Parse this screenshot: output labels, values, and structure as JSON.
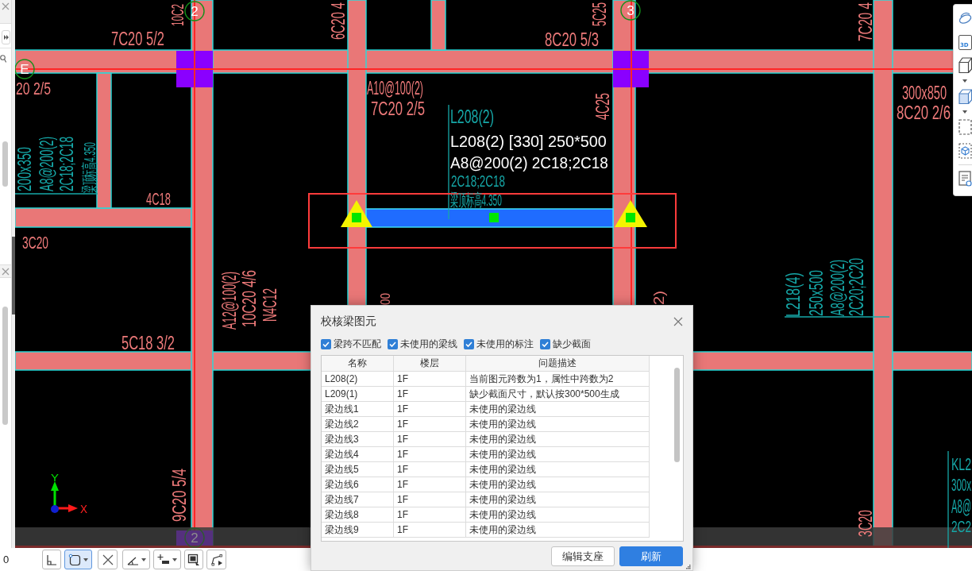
{
  "drawing": {
    "axis_bubbles": [
      {
        "label": "2"
      },
      {
        "label": "3"
      },
      {
        "label": "E"
      },
      {
        "label": "2"
      }
    ],
    "reinforcement_notes": [
      "10C2",
      "7C20 5/2",
      "20 2/5",
      "4C18",
      "3C20",
      "6C20 4",
      "A10@100(2)",
      "7C20 2/5",
      "8C20 5/3",
      "5C25",
      "4C25",
      "7C20 4",
      "300x850",
      "8C20 2/6",
      "A12@100(2)",
      "10C20 4/6",
      "N4C12",
      "5C18 3/2",
      "9C20 5/4",
      "3C20",
      "00",
      "2)"
    ],
    "beam_notes": [
      {
        "lines": [
          "200x350",
          "A8@200(2)",
          "2C18;2C18",
          "梁顶标高4.350"
        ]
      },
      {
        "lines": [
          "L208(2)",
          "2C18;2C18",
          "梁顶标高4.350"
        ]
      },
      {
        "lines": [
          "L218(4)",
          "250x500",
          "A8@200(2)",
          "2C20;2C20"
        ]
      },
      {
        "lines": [
          "KL2",
          "300x",
          "A8@",
          "2C2"
        ]
      }
    ],
    "selected_beam": {
      "tooltip": [
        "L208(2) [330] 250*500",
        "A8@200(2) 2C18;2C18"
      ]
    },
    "ucs": {
      "x_label": "X",
      "y_label": "Y"
    }
  },
  "view_toolbar": {
    "view_label": "3D"
  },
  "draw_toolbar": {
    "status_value": "0",
    "tools": [
      {
        "selected": false,
        "menu": false
      },
      {
        "selected": true,
        "menu": true
      },
      {
        "selected": false,
        "menu": false
      },
      {
        "selected": false,
        "menu": true
      },
      {
        "selected": false,
        "menu": true
      },
      {
        "selected": false,
        "menu": false
      },
      {
        "selected": false,
        "menu": false
      }
    ]
  },
  "dialog": {
    "title": "校核梁图元",
    "filters": [
      {
        "label": "梁跨不匹配",
        "checked": true
      },
      {
        "label": "未使用的梁线",
        "checked": true
      },
      {
        "label": "未使用的标注",
        "checked": true
      },
      {
        "label": "缺少截面",
        "checked": true
      }
    ],
    "table": {
      "columns": [
        "名称",
        "楼层",
        "问题描述"
      ],
      "rows": [
        [
          "L208(2)",
          "1F",
          "当前图元跨数为1，属性中跨数为2"
        ],
        [
          "L209(1)",
          "1F",
          "缺少截面尺寸，默认按300*500生成"
        ],
        [
          "梁边线1",
          "1F",
          "未使用的梁边线"
        ],
        [
          "梁边线2",
          "1F",
          "未使用的梁边线"
        ],
        [
          "梁边线3",
          "1F",
          "未使用的梁边线"
        ],
        [
          "梁边线4",
          "1F",
          "未使用的梁边线"
        ],
        [
          "梁边线5",
          "1F",
          "未使用的梁边线"
        ],
        [
          "梁边线6",
          "1F",
          "未使用的梁边线"
        ],
        [
          "梁边线7",
          "1F",
          "未使用的梁边线"
        ],
        [
          "梁边线8",
          "1F",
          "未使用的梁边线"
        ],
        [
          "梁边线9",
          "1F",
          "未使用的梁边线"
        ]
      ]
    },
    "buttons": [
      {
        "label": "编辑支座",
        "kind": "secondary"
      },
      {
        "label": "刷新",
        "kind": "primary"
      }
    ]
  }
}
